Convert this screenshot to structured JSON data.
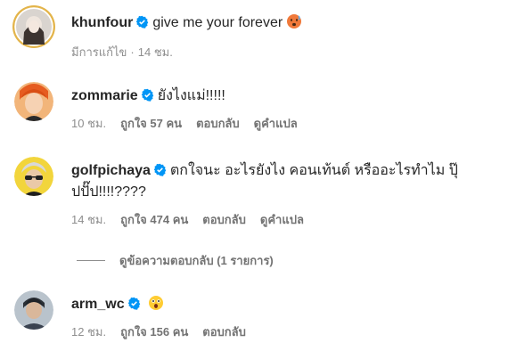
{
  "caption": {
    "username": "khunfour",
    "text": "give me your forever",
    "emoji": "hot-face-emoji",
    "edited": "มีการแก้ไข",
    "time": "14 ชม."
  },
  "comments": [
    {
      "username": "zommarie",
      "text": "ยังไงแม่!!!!!",
      "time": "10 ชม.",
      "likes": "ถูกใจ 57 คน",
      "reply": "ตอบกลับ",
      "translate": "ดูคำแปล"
    },
    {
      "username": "golfpichaya",
      "text_line1": "ตกใจนะ อะไรยังไง คอนเท้นต์ หรืออะไรทำไม ปุ๊",
      "text_line2": "ปปั๊ป!!!!????",
      "time": "14 ชม.",
      "likes": "ถูกใจ 474 คน",
      "reply": "ตอบกลับ",
      "translate": "ดูคำแปล",
      "view_replies": "ดูข้อความตอบกลับ (1 รายการ)"
    },
    {
      "username": "arm_wc",
      "emoji": "astonished-face-emoji",
      "time": "12 ชม.",
      "likes": "ถูกใจ 156 คน",
      "reply": "ตอบกลับ"
    }
  ],
  "colors": {
    "verified": "#0095f6",
    "story_ring": "#ffc107"
  }
}
